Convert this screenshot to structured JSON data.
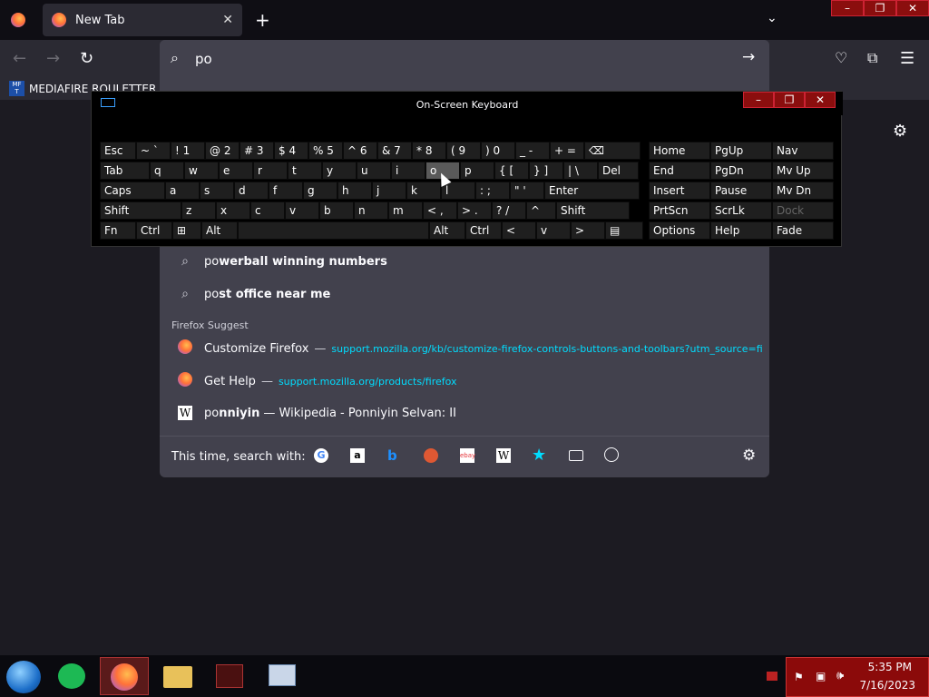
{
  "tab": {
    "title": "New Tab"
  },
  "url": {
    "value": "po"
  },
  "bookmarks": {
    "item": "MEDIAFIRE ROULETTER"
  },
  "suggestions": [
    {
      "prefix": "po",
      "rest": "werball winning numbers"
    },
    {
      "prefix": "po",
      "rest": "st office near me"
    }
  ],
  "firefox_suggest": {
    "heading": "Firefox Suggest",
    "items": [
      {
        "title": "Customize Firefox",
        "sep": "—",
        "url": "support.mozilla.org/kb/customize-firefox-controls-buttons-and-toolbars?utm_source=fir"
      },
      {
        "title": "Get Help",
        "sep": "—",
        "url": "support.mozilla.org/products/firefox"
      }
    ],
    "wiki": {
      "prefix": "po",
      "rest": "nniyin",
      "tail": "— Wikipedia - Ponniyin Selvan: II"
    }
  },
  "search_with": {
    "label": "This time, search with:"
  },
  "osk": {
    "title": "On-Screen Keyboard",
    "row1": [
      "Esc",
      "~ `",
      "! 1",
      "@ 2",
      "# 3",
      "$ 4",
      "% 5",
      "^ 6",
      "& 7",
      "* 8",
      "( 9",
      ") 0",
      "_ -",
      "+ ="
    ],
    "row2": [
      "Tab",
      "q",
      "w",
      "e",
      "r",
      "t",
      "y",
      "u",
      "i",
      "o",
      "p",
      "{ [",
      "} ]",
      "| \\",
      "Del"
    ],
    "row3": [
      "Caps",
      "a",
      "s",
      "d",
      "f",
      "g",
      "h",
      "j",
      "k",
      "l",
      ": ;",
      "\" '",
      "Enter"
    ],
    "row4": [
      "Shift",
      "z",
      "x",
      "c",
      "v",
      "b",
      "n",
      "m",
      "< ,",
      "> .",
      "? /",
      "^",
      "Shift"
    ],
    "row5": [
      "Fn",
      "Ctrl",
      "Alt",
      "Alt",
      "Ctrl",
      "<",
      "v",
      ">"
    ],
    "side": [
      [
        "Home",
        "PgUp",
        "Nav"
      ],
      [
        "End",
        "PgDn",
        "Mv Up"
      ],
      [
        "Insert",
        "Pause",
        "Mv Dn"
      ],
      [
        "PrtScn",
        "ScrLk",
        "Dock"
      ],
      [
        "Options",
        "Help",
        "Fade"
      ]
    ]
  },
  "clock": {
    "time": "5:35 PM",
    "date": "7/16/2023"
  },
  "colors": {
    "accent": "#00ddff",
    "tray": "#8b0a0a"
  }
}
